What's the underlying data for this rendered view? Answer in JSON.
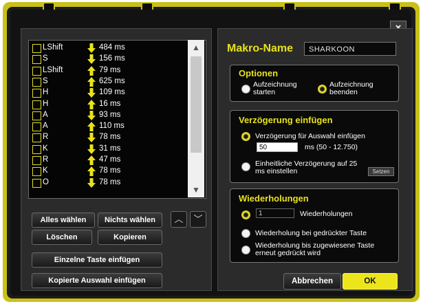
{
  "window": {
    "close_label": "×"
  },
  "list": {
    "rows": [
      {
        "key": "LShift",
        "dir": "down",
        "ms": "484 ms"
      },
      {
        "key": "S",
        "dir": "down",
        "ms": "156 ms"
      },
      {
        "key": "LShift",
        "dir": "up",
        "ms": "79 ms"
      },
      {
        "key": "S",
        "dir": "up",
        "ms": "625 ms"
      },
      {
        "key": "H",
        "dir": "down",
        "ms": "109 ms"
      },
      {
        "key": "H",
        "dir": "up",
        "ms": "16 ms"
      },
      {
        "key": "A",
        "dir": "down",
        "ms": "93 ms"
      },
      {
        "key": "A",
        "dir": "up",
        "ms": "110 ms"
      },
      {
        "key": "R",
        "dir": "down",
        "ms": "78 ms"
      },
      {
        "key": "K",
        "dir": "down",
        "ms": "31 ms"
      },
      {
        "key": "R",
        "dir": "up",
        "ms": "47 ms"
      },
      {
        "key": "K",
        "dir": "up",
        "ms": "78 ms"
      },
      {
        "key": "O",
        "dir": "down",
        "ms": "78 ms"
      }
    ],
    "scroll_up_icon": "▲",
    "scroll_down_icon": "▼"
  },
  "buttons": {
    "select_all": "Alles wählen",
    "select_none": "Nichts wählen",
    "delete": "Löschen",
    "copy": "Kopieren",
    "insert_key": "Einzelne Taste einfügen",
    "paste_selection": "Kopierte Auswahl einfügen",
    "move_up": "︿",
    "move_down": "﹀"
  },
  "macro": {
    "name_label": "Makro-Name",
    "name_value": "SHARKOON"
  },
  "options": {
    "title": "Optionen",
    "start_recording": "Aufzeichnung starten",
    "stop_recording": "Aufzeichnung beenden",
    "selected": "stop_recording"
  },
  "delay": {
    "title": "Verzögerung einfügen",
    "insert_for_selection": "Verzögerung für Auswahl einfügen",
    "delay_value": "50",
    "range_hint": "ms (50 - 12.750)",
    "uniform_delay": "Einheitliche Verzögerung auf 25 ms einstellen",
    "set_button": "Setzen",
    "selected": "insert_for_selection"
  },
  "repeat": {
    "title": "Wiederholungen",
    "count_value": "1",
    "count_label": "Wiederholungen",
    "while_pressed": "Wiederholung bei gedrückter Taste",
    "until_pressed_again": "Wiederholung bis zugewiesene Taste erneut gedrückt wird",
    "selected": "count"
  },
  "footer": {
    "cancel": "Abbrechen",
    "ok": "OK"
  },
  "colors": {
    "accent": "#e8e21c",
    "frame": "#c9c11a",
    "panel": "#2b2b2b"
  }
}
